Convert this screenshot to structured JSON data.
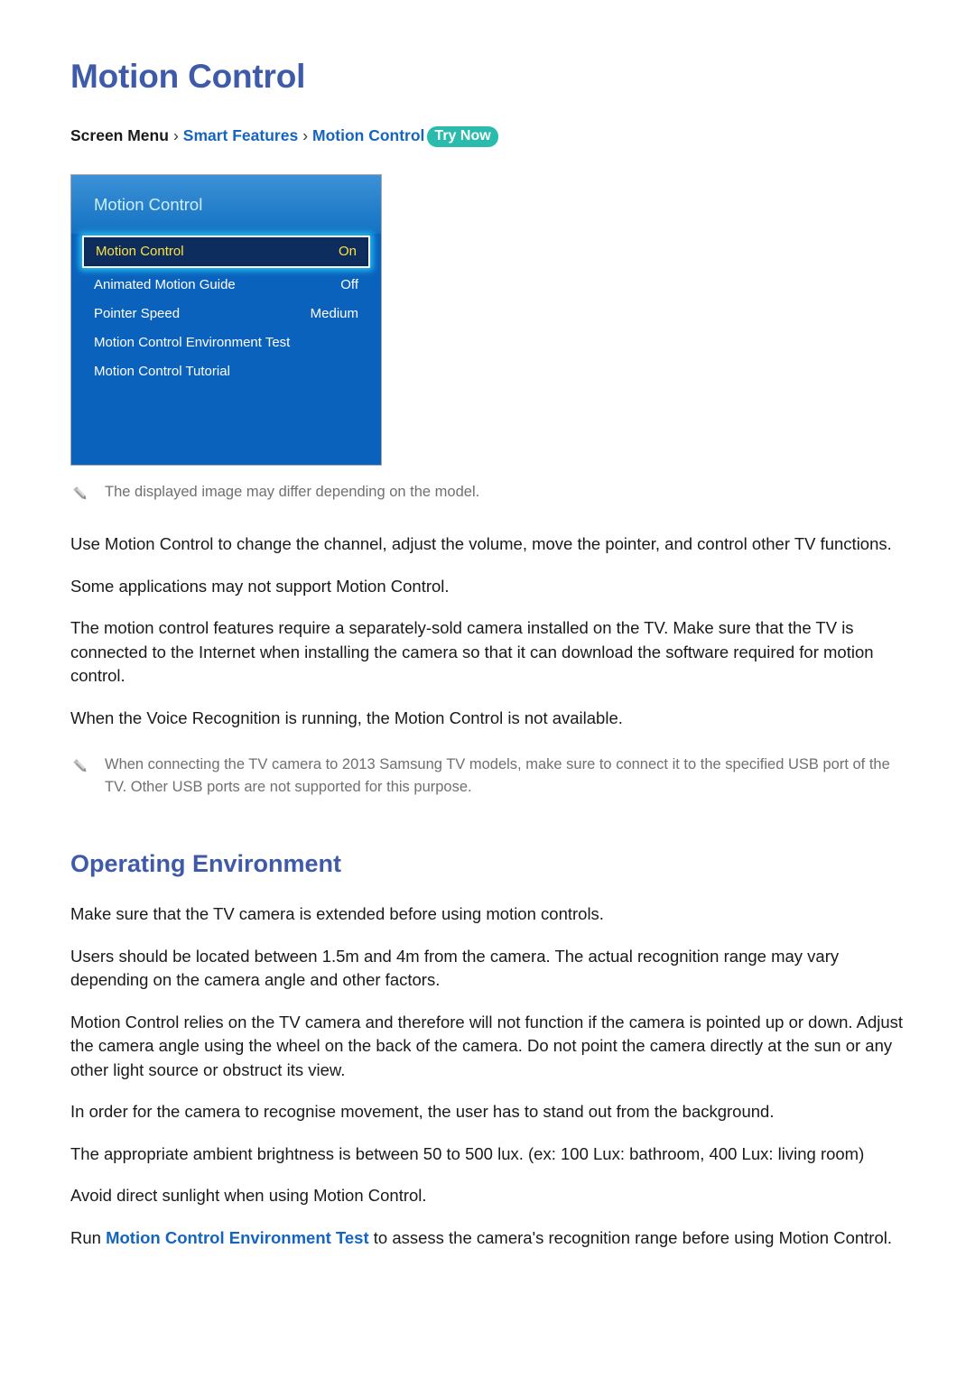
{
  "page": {
    "title": "Motion Control"
  },
  "breadcrumb": {
    "root": "Screen Menu",
    "separator": "›",
    "level2": "Smart Features",
    "level3": "Motion Control",
    "badge": "Try Now",
    "badge_color": "#2bbbad",
    "link_color": "#1565c0"
  },
  "tv_menu": {
    "header_title": "Motion Control",
    "rows": [
      {
        "label": "Motion Control",
        "value": "On",
        "selected": true
      },
      {
        "label": "Animated Motion Guide",
        "value": "Off",
        "selected": false
      },
      {
        "label": "Pointer Speed",
        "value": "Medium",
        "selected": false
      },
      {
        "label": "Motion Control Environment Test",
        "value": "",
        "selected": false
      },
      {
        "label": "Motion Control Tutorial",
        "value": "",
        "selected": false
      }
    ],
    "panel_color": "#0b62bc",
    "selected_text_color": "#ffe23c",
    "highlight_glow_color": "#23c0f5"
  },
  "notes": {
    "image_note": "The displayed image may differ depending on the model.",
    "usb_note": "When connecting the TV camera to 2013 Samsung TV models, make sure to connect it to the specified USB port of the TV. Other USB ports are not supported for this purpose.",
    "icon": "pencil-icon",
    "text_color": "#707070"
  },
  "body": {
    "p1": "Use Motion Control to change the channel, adjust the volume, move the pointer, and control other TV functions.",
    "p2": "Some applications may not support Motion Control.",
    "p3": "The motion control features require a separately-sold camera installed on the TV. Make sure that the TV is connected to the Internet when installing the camera so that it can download the software required for motion control.",
    "p4": "When the Voice Recognition is running, the Motion Control is not available."
  },
  "operating_environment": {
    "title": "Operating Environment",
    "p1": "Make sure that the TV camera is extended before using motion controls.",
    "p2": "Users should be located between 1.5m and 4m from the camera. The actual recognition range may vary depending on the camera angle and other factors.",
    "p3": "Motion Control relies on the TV camera and therefore will not function if the camera is pointed up or down. Adjust the camera angle using the wheel on the back of the camera. Do not point the camera directly at the sun or any other light source or obstruct its view.",
    "p4": "In order for the camera to recognise movement, the user has to stand out from the background.",
    "p5": "The appropriate ambient brightness is between 50 to 500 lux. (ex: 100 Lux: bathroom, 400 Lux: living room)",
    "p6": "Avoid direct sunlight when using Motion Control.",
    "p7_prefix": "Run ",
    "p7_link": "Motion Control Environment Test",
    "p7_suffix": " to assess the camera's recognition range before using Motion Control."
  }
}
